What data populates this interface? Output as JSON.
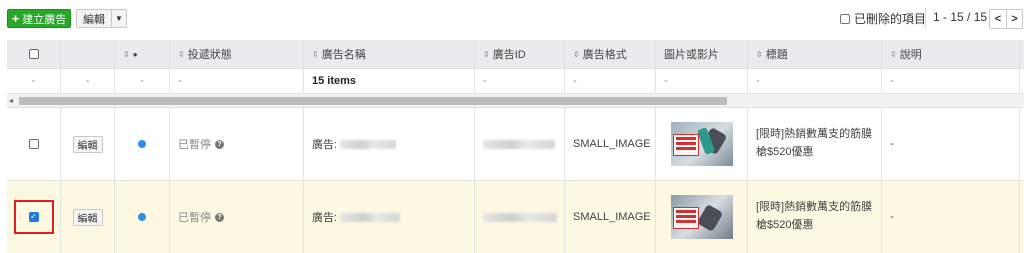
{
  "toolbar": {
    "create_label": "建立廣告",
    "edit_label": "編輯",
    "show_deleted_label": "已刪除的項目",
    "pager_text": "1 - 15 / 15"
  },
  "table": {
    "headers": {
      "status_dot": "●",
      "delivery": "投遞狀態",
      "name": "廣告名稱",
      "ad_id": "廣告ID",
      "format": "廣告格式",
      "media": "圖片或影片",
      "title": "標題",
      "description": "說明"
    },
    "summary": {
      "dash": "-",
      "items": "15 items"
    },
    "rows": [
      {
        "selected": false,
        "edit_label": "編輯",
        "status": "已暫停",
        "name_prefix": "廣告:",
        "format": "SMALL_IMAGE",
        "title": "[限時]熱銷數萬支的筋膜槍$520優惠",
        "description": "-"
      },
      {
        "selected": true,
        "edit_label": "編輯",
        "status": "已暫停",
        "name_prefix": "廣告:",
        "format": "SMALL_IMAGE",
        "title": "[限時]熱銷數萬支的筋膜槍$520優惠",
        "description": "-"
      }
    ]
  },
  "colors": {
    "create_button": "#28a728",
    "status_dot": "#2b8de8",
    "selected_row": "#fdf8e2",
    "highlight_box": "#e02020"
  }
}
